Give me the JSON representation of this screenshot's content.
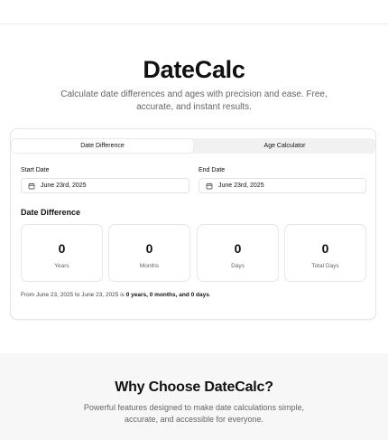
{
  "hero": {
    "title": "DateCalc",
    "subtitle": "Calculate date differences and ages with precision and ease. Free, accurate, and instant results."
  },
  "tabs": [
    {
      "label": "Date Difference",
      "active": true
    },
    {
      "label": "Age Calculator",
      "active": false
    }
  ],
  "form": {
    "start_label": "Start Date",
    "start_value": "June 23rd, 2025",
    "end_label": "End Date",
    "end_value": "June 23rd, 2025"
  },
  "result": {
    "title": "Date Difference",
    "stats": [
      {
        "value": "0",
        "label": "Years"
      },
      {
        "value": "0",
        "label": "Months"
      },
      {
        "value": "0",
        "label": "Days"
      },
      {
        "value": "0",
        "label": "Total Days"
      }
    ],
    "summary_prefix": "From June 23, 2025 to June 23, 2025 is ",
    "summary_bold": "0 years, 0 months, and 0 days",
    "summary_suffix": "."
  },
  "why": {
    "title": "Why Choose DateCalc?",
    "subtitle": "Powerful features designed to make date calculations simple, accurate, and accessible for everyone."
  },
  "icons": {
    "start_icon": "calendar-icon",
    "end_icon": "calendar-icon"
  }
}
